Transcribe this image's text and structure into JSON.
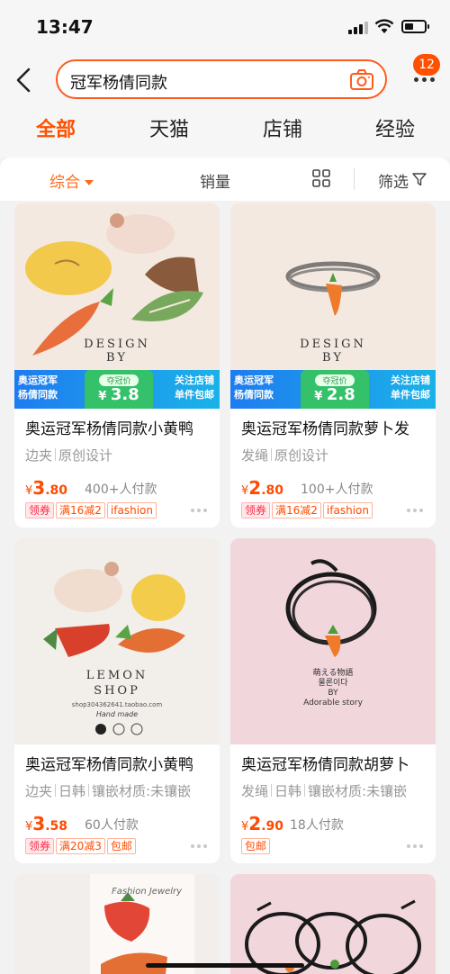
{
  "status": {
    "time": "13:47"
  },
  "header": {
    "search_query": "冠军杨倩同款",
    "badge_count": "12"
  },
  "tabs": [
    "全部",
    "天猫",
    "店铺",
    "经验"
  ],
  "sort": {
    "comprehensive": "综合",
    "sales": "销量",
    "filter": "筛选"
  },
  "banner_text": {
    "left_line1": "奥运冠军",
    "left_line2": "杨倩同款",
    "mid_label": "夺冠价",
    "right_line1": "关注店铺",
    "right_line2": "单件包邮"
  },
  "products": [
    {
      "title": "奥运冠军杨倩同款小黄鸭",
      "attrs": [
        "边夹",
        "原创设计"
      ],
      "price_cur": "¥",
      "price_int": "3",
      "price_dec": ".80",
      "sold": "400+人付款",
      "tags": [
        "领券",
        "满16减2",
        "ifashion"
      ],
      "banner_price": "3.8",
      "image_text": "DESIGN\nBY"
    },
    {
      "title": "奥运冠军杨倩同款萝卜发",
      "attrs": [
        "发绳",
        "原创设计"
      ],
      "price_cur": "¥",
      "price_int": "2",
      "price_dec": ".80",
      "sold": "100+人付款",
      "tags": [
        "领券",
        "满16减2",
        "ifashion"
      ],
      "banner_price": "2.8",
      "image_text": "DESIGN\nBY"
    },
    {
      "title": "奥运冠军杨倩同款小黄鸭",
      "attrs": [
        "边夹",
        "日韩",
        "镶嵌材质:未镶嵌"
      ],
      "price_cur": "¥",
      "price_int": "3",
      "price_dec": ".58",
      "sold": "60人付款",
      "tags": [
        "领券",
        "满20减3",
        "包邮"
      ],
      "image_text": "LEMON\nSHOP",
      "image_sub": "shop304362641.taobao.com",
      "image_script": "Hand made"
    },
    {
      "title": "奥运冠军杨倩同款胡萝卜",
      "attrs": [
        "发绳",
        "日韩",
        "镶嵌材质:未镶嵌"
      ],
      "price_cur": "¥",
      "price_int": "2",
      "price_dec": ".90",
      "sold": "18人付款",
      "tags": [
        "包邮"
      ],
      "image_text": "萌える物語\n물론이다\nBY\nAdorable story"
    },
    {
      "image_text": "Fashion Jewelry"
    },
    {}
  ],
  "colors": {
    "accent": "#ff5000",
    "price": "#ff4a00",
    "banner_blue": "#1e7cf0"
  }
}
